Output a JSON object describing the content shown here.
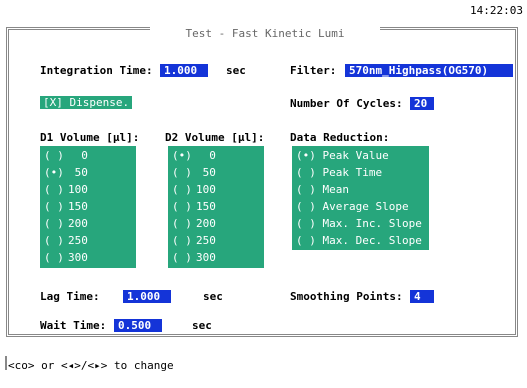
{
  "clock": "14:22:03",
  "title": "Test - Fast Kinetic Lumi",
  "integration": {
    "label": "Integration Time:",
    "value": "1.000",
    "unit": "sec"
  },
  "filter": {
    "label": "Filter:",
    "value": "570nm_Highpass(OG570)"
  },
  "dispense": {
    "label": "[X] Dispense."
  },
  "cycles": {
    "label": "Number Of Cycles:",
    "value": "20"
  },
  "d1": {
    "label": "D1 Volume [µl]:",
    "items": [
      {
        "mark": "( )",
        "value": "0"
      },
      {
        "mark": "(•)",
        "value": "50"
      },
      {
        "mark": "( )",
        "value": "100"
      },
      {
        "mark": "( )",
        "value": "150"
      },
      {
        "mark": "( )",
        "value": "200"
      },
      {
        "mark": "( )",
        "value": "250"
      },
      {
        "mark": "( )",
        "value": "300"
      }
    ]
  },
  "d2": {
    "label": "D2 Volume [µl]:",
    "items": [
      {
        "mark": "(•)",
        "value": "0"
      },
      {
        "mark": "( )",
        "value": "50"
      },
      {
        "mark": "( )",
        "value": "100"
      },
      {
        "mark": "( )",
        "value": "150"
      },
      {
        "mark": "( )",
        "value": "200"
      },
      {
        "mark": "( )",
        "value": "250"
      },
      {
        "mark": "( )",
        "value": "300"
      }
    ]
  },
  "reduction": {
    "label": "Data Reduction:",
    "items": [
      {
        "mark": "(•)",
        "label": "Peak Value"
      },
      {
        "mark": "( )",
        "label": "Peak Time"
      },
      {
        "mark": "( )",
        "label": "Mean"
      },
      {
        "mark": "( )",
        "label": "Average Slope"
      },
      {
        "mark": "( )",
        "label": "Max. Inc. Slope"
      },
      {
        "mark": "( )",
        "label": "Max. Dec. Slope"
      }
    ]
  },
  "lag": {
    "label": "Lag Time:",
    "value": "1.000",
    "unit": "sec"
  },
  "smoothing": {
    "label": "Smoothing Points:",
    "value": "4"
  },
  "wait": {
    "label": "Wait Time:",
    "value": "0.500",
    "unit": "sec"
  },
  "status": "<co> or <◂>/<▸> to change"
}
